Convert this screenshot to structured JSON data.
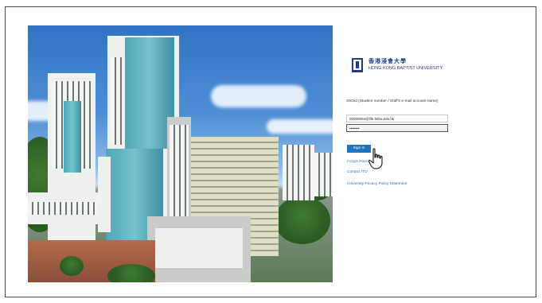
{
  "login": {
    "logo": {
      "chinese_name": "香港浸會大學",
      "english_name": "HONG KONG BAPTIST UNIVERSITY"
    },
    "field_label": "SSOid (Student number / Staff's e-mail account name)",
    "username_value": "00000004@life.hkbu.edu.hk",
    "password_value": "••••••••",
    "sign_in_label": "Sign in",
    "links": {
      "forgot_password": "Forgot Pass",
      "contact_its": "Contact ITO",
      "privacy_policy": "University Privacy Policy Statement"
    }
  },
  "icons": {
    "cursor": "hand-pointer-icon",
    "logo": "university-logo-icon"
  },
  "colors": {
    "brand_blue": "#1f3c88",
    "button_blue": "#1e73be"
  }
}
